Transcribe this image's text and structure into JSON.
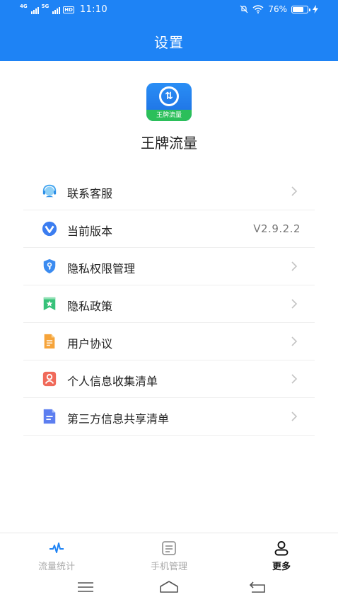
{
  "status_bar": {
    "network_1": "4G",
    "network_2": "5G",
    "hd": "HD",
    "time": "11:10",
    "battery": "76%",
    "battery_level": 0.76
  },
  "header": {
    "title": "设置"
  },
  "app": {
    "logo_text": "王牌流量",
    "name": "王牌流量"
  },
  "menu": [
    {
      "label": "联系客服",
      "icon": "customer-service-icon"
    },
    {
      "label": "当前版本",
      "icon": "version-icon",
      "value": "V2.9.2.2"
    },
    {
      "label": "隐私权限管理",
      "icon": "shield-icon"
    },
    {
      "label": "隐私政策",
      "icon": "bookmark-star-icon"
    },
    {
      "label": "用户协议",
      "icon": "document-icon"
    },
    {
      "label": "个人信息收集清单",
      "icon": "person-card-icon"
    },
    {
      "label": "第三方信息共享清单",
      "icon": "list-doc-icon"
    }
  ],
  "tabs": [
    {
      "label": "流量统计",
      "icon": "pulse-icon",
      "active": false
    },
    {
      "label": "手机管理",
      "icon": "clipboard-icon",
      "active": false
    },
    {
      "label": "更多",
      "icon": "user-icon",
      "active": true
    }
  ],
  "colors": {
    "primary": "#1e83f5",
    "green": "#2bbf5a"
  }
}
